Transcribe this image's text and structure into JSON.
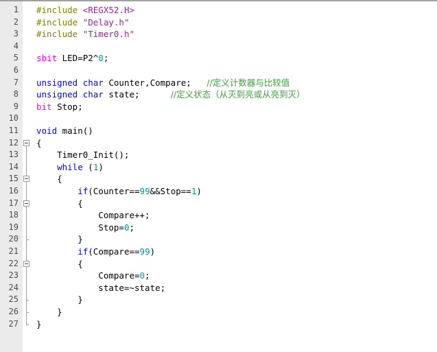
{
  "editor": {
    "name": "c-source-code-editor",
    "language": "C (8051 / Keil)",
    "total_lines": 27,
    "colors": {
      "background": "#ffffff",
      "gutter_background": "#ebebeb",
      "line_number": "#4d4d4d",
      "keyword": "#0000ff",
      "type_keyword": "#ff00ff",
      "preprocessor": "#808000",
      "string": "#a020a0",
      "number": "#009999",
      "comment": "#3f9f3f",
      "fold_line": "#9a9a9a",
      "top_border": "#a0a0a0"
    }
  },
  "lines": [
    {
      "n": "1",
      "tokens": [
        {
          "t": "#include ",
          "c": "pre"
        },
        {
          "t": "<REGX52.H>",
          "c": "str"
        }
      ]
    },
    {
      "n": "2",
      "tokens": [
        {
          "t": "#include ",
          "c": "pre"
        },
        {
          "t": "\"Delay.h\"",
          "c": "str"
        }
      ]
    },
    {
      "n": "3",
      "tokens": [
        {
          "t": "#include ",
          "c": "pre"
        },
        {
          "t": "\"Timer0.h\"",
          "c": "str"
        }
      ]
    },
    {
      "n": "4",
      "tokens": []
    },
    {
      "n": "5",
      "tokens": [
        {
          "t": "sbit",
          "c": "kw2"
        },
        {
          "t": " LED=P2^",
          "c": ""
        },
        {
          "t": "0",
          "c": "num"
        },
        {
          "t": ";",
          "c": ""
        }
      ]
    },
    {
      "n": "6",
      "tokens": []
    },
    {
      "n": "7",
      "tokens": [
        {
          "t": "unsigned char",
          "c": "kw"
        },
        {
          "t": " Counter,Compare;   ",
          "c": ""
        },
        {
          "t": "//定义计数器与比较值",
          "c": "cmt cn"
        }
      ]
    },
    {
      "n": "8",
      "tokens": [
        {
          "t": "unsigned char",
          "c": "kw"
        },
        {
          "t": " state;      ",
          "c": ""
        },
        {
          "t": "//定义状态（从灭到亮或从亮到灭）",
          "c": "cmt cn"
        }
      ]
    },
    {
      "n": "9",
      "tokens": [
        {
          "t": "bit",
          "c": "kw2"
        },
        {
          "t": " Stop;",
          "c": ""
        }
      ]
    },
    {
      "n": "10",
      "tokens": []
    },
    {
      "n": "11",
      "tokens": [
        {
          "t": "void",
          "c": "kw"
        },
        {
          "t": " main()",
          "c": ""
        }
      ]
    },
    {
      "n": "12",
      "tokens": [
        {
          "t": "{",
          "c": ""
        }
      ]
    },
    {
      "n": "13",
      "tokens": [
        {
          "t": "    Timer0_Init();",
          "c": ""
        }
      ]
    },
    {
      "n": "14",
      "tokens": [
        {
          "t": "    ",
          "c": ""
        },
        {
          "t": "while",
          "c": "kw"
        },
        {
          "t": " (",
          "c": ""
        },
        {
          "t": "1",
          "c": "num"
        },
        {
          "t": ")",
          "c": ""
        }
      ]
    },
    {
      "n": "15",
      "tokens": [
        {
          "t": "    {",
          "c": ""
        }
      ]
    },
    {
      "n": "16",
      "tokens": [
        {
          "t": "        ",
          "c": ""
        },
        {
          "t": "if",
          "c": "kw"
        },
        {
          "t": "(Counter==",
          "c": ""
        },
        {
          "t": "99",
          "c": "num"
        },
        {
          "t": "&&Stop==",
          "c": ""
        },
        {
          "t": "1",
          "c": "num"
        },
        {
          "t": ")",
          "c": ""
        }
      ]
    },
    {
      "n": "17",
      "tokens": [
        {
          "t": "        {",
          "c": ""
        }
      ]
    },
    {
      "n": "18",
      "tokens": [
        {
          "t": "            Compare++;",
          "c": ""
        }
      ]
    },
    {
      "n": "19",
      "tokens": [
        {
          "t": "            Stop=",
          "c": ""
        },
        {
          "t": "0",
          "c": "num"
        },
        {
          "t": ";",
          "c": ""
        }
      ]
    },
    {
      "n": "20",
      "tokens": [
        {
          "t": "        }",
          "c": ""
        }
      ]
    },
    {
      "n": "21",
      "tokens": [
        {
          "t": "        ",
          "c": ""
        },
        {
          "t": "if",
          "c": "kw"
        },
        {
          "t": "(Compare==",
          "c": ""
        },
        {
          "t": "99",
          "c": "num"
        },
        {
          "t": ")",
          "c": ""
        }
      ]
    },
    {
      "n": "22",
      "tokens": [
        {
          "t": "        {",
          "c": ""
        }
      ]
    },
    {
      "n": "23",
      "tokens": [
        {
          "t": "            Compare=",
          "c": ""
        },
        {
          "t": "0",
          "c": "num"
        },
        {
          "t": ";",
          "c": ""
        }
      ]
    },
    {
      "n": "24",
      "tokens": [
        {
          "t": "            state=~state;",
          "c": ""
        }
      ]
    },
    {
      "n": "25",
      "tokens": [
        {
          "t": "        }",
          "c": ""
        }
      ]
    },
    {
      "n": "26",
      "tokens": [
        {
          "t": "    }",
          "c": ""
        }
      ]
    },
    {
      "n": "27",
      "tokens": [
        {
          "t": "}",
          "c": ""
        }
      ]
    }
  ],
  "folding": {
    "regions": [
      {
        "name": "main-body-fold",
        "open_line": 12,
        "close_line": 27
      },
      {
        "name": "while-body-fold",
        "open_line": 15,
        "close_line": 26
      },
      {
        "name": "if-counter-body-fold",
        "open_line": 17,
        "close_line": 20
      },
      {
        "name": "if-compare-body-fold",
        "open_line": 22,
        "close_line": 25
      }
    ]
  }
}
